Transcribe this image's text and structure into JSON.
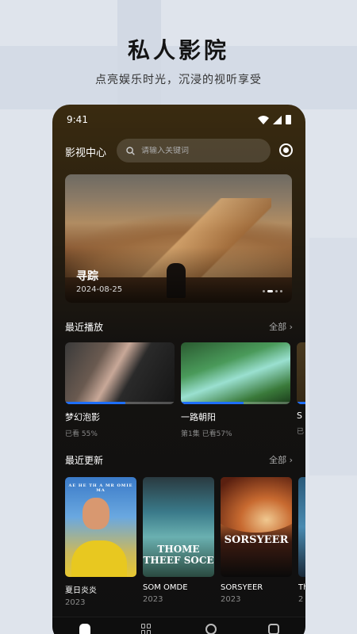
{
  "promo": {
    "headline": "私人影院",
    "subline": "点亮娱乐时光，沉浸的视听享受"
  },
  "status_bar": {
    "time": "9:41"
  },
  "header": {
    "app_title": "影视中心",
    "search_placeholder": "请输入关键词"
  },
  "banner": {
    "title": "寻踪",
    "date": "2024-08-25",
    "page_count": 4,
    "active_page": 1
  },
  "recent": {
    "title": "最近播放",
    "more_label": "全部",
    "items": [
      {
        "name": "梦幻泡影",
        "meta": "已看 55%",
        "progress": 0.55
      },
      {
        "name": "一路朝阳",
        "meta": "第1集  已看57%",
        "progress": 0.57
      },
      {
        "name": "S",
        "meta": "已",
        "progress": 0.3
      }
    ]
  },
  "updates": {
    "title": "最近更新",
    "more_label": "全部",
    "items": [
      {
        "name": "夏日炎炎",
        "year": "2023",
        "poster_text": "AE HE TH A MR OMIE MA"
      },
      {
        "name": "SOM OMDE",
        "year": "2023",
        "poster_text": "THOME THEEF SOCE"
      },
      {
        "name": "SORSYEER",
        "year": "2023",
        "poster_text": "SORSYEER"
      },
      {
        "name": "Th",
        "year": "2",
        "poster_text": ""
      }
    ]
  },
  "nav": {
    "items": [
      "home",
      "categories",
      "discover",
      "profile"
    ]
  },
  "colors": {
    "accent": "#1e6fff",
    "background": "#dfe4ec"
  }
}
